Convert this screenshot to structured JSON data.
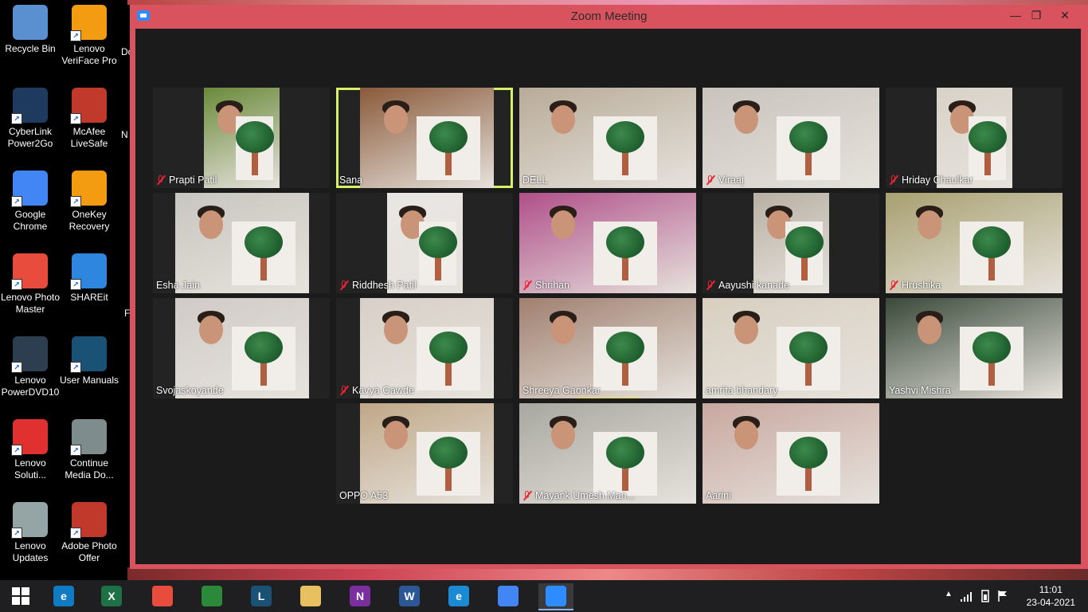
{
  "desktop": {
    "icons": [
      {
        "label": "Recycle Bin",
        "icon": "recycle-bin-icon",
        "color": "#5a8fd0"
      },
      {
        "label": "Lenovo VeriFace Pro",
        "icon": "veriface-icon",
        "color": "#f39c12"
      },
      {
        "label": "CyberLink Power2Go",
        "icon": "power2go-icon",
        "color": "#1e3a5f"
      },
      {
        "label": "McAfee LiveSafe",
        "icon": "mcafee-icon",
        "color": "#c0392b"
      },
      {
        "label": "Google Chrome",
        "icon": "chrome-icon",
        "color": "#4285f4"
      },
      {
        "label": "OneKey Recovery",
        "icon": "onekey-icon",
        "color": "#f39c12"
      },
      {
        "label": "Lenovo Photo Master",
        "icon": "photo-master-icon",
        "color": "#e74c3c"
      },
      {
        "label": "SHAREit",
        "icon": "shareit-icon",
        "color": "#2e86de"
      },
      {
        "label": "Lenovo PowerDVD10",
        "icon": "powerdvd-icon",
        "color": "#2c3e50"
      },
      {
        "label": "User Manuals",
        "icon": "user-manuals-icon",
        "color": "#1a5276"
      },
      {
        "label": "Lenovo Soluti...",
        "icon": "lenovo-solution-icon",
        "color": "#e03030"
      },
      {
        "label": "Continue Media Do...",
        "icon": "media-doc-icon",
        "color": "#7f8c8d"
      },
      {
        "label": "Lenovo Updates",
        "icon": "lenovo-updates-icon",
        "color": "#95a5a6"
      },
      {
        "label": "Adobe Photo Offer",
        "icon": "adobe-icon",
        "color": "#c0392b"
      }
    ],
    "partial": [
      "Do",
      "N",
      "F"
    ]
  },
  "window": {
    "title": "Zoom Meeting",
    "minimize": "—",
    "restore": "❐",
    "close": "✕"
  },
  "participants": [
    {
      "name": "Prapti Patil",
      "muted": true,
      "bg": "#6a8a3a"
    },
    {
      "name": "Sana",
      "muted": false,
      "bg": "#8a5a3a",
      "active": true
    },
    {
      "name": "DELL",
      "muted": false,
      "bg": "#b8ab98"
    },
    {
      "name": "Viraaj",
      "muted": true,
      "bg": "#c8c4bc"
    },
    {
      "name": "Hriday Chaulkar",
      "muted": true,
      "bg": "#d8d2c8"
    },
    {
      "name": "Esha Jain",
      "muted": false,
      "bg": "#c8c6c0"
    },
    {
      "name": "Riddhesh Patil",
      "muted": true,
      "bg": "#e8e6e4"
    },
    {
      "name": "Shrihan",
      "muted": true,
      "bg": "#b0508a"
    },
    {
      "name": "Aayushi kanade",
      "muted": true,
      "bg": "#b8b0a4"
    },
    {
      "name": "Hrushika",
      "muted": true,
      "bg": "#a8a070"
    },
    {
      "name": "Svojaskoyande",
      "muted": false,
      "bg": "#d0cbc8"
    },
    {
      "name": "Kavya Gawde",
      "muted": true,
      "bg": "#d8d0c8"
    },
    {
      "name": "Shreeya Gaonkar",
      "muted": false,
      "bg": "#a08070",
      "speaking": true
    },
    {
      "name": "amrita bhandary",
      "muted": false,
      "bg": "#d8cfc0"
    },
    {
      "name": "Yashvi Mishra",
      "muted": false,
      "bg": "#3a4a3a"
    },
    {
      "name": "OPPO A53",
      "muted": false,
      "bg": "#c0a888"
    },
    {
      "name": "Mayank Umesh Man...",
      "muted": true,
      "bg": "#a8a8a0"
    },
    {
      "name": "Aarini",
      "muted": false,
      "bg": "#c8a8a0"
    }
  ],
  "taskbar": {
    "apps": [
      {
        "name": "edge",
        "icon": "edge-icon",
        "color": "#0f7bc4",
        "glyph": "e"
      },
      {
        "name": "excel",
        "icon": "excel-icon",
        "color": "#1e7145",
        "glyph": "X"
      },
      {
        "name": "photo-master",
        "icon": "photo-master-task-icon",
        "color": "#e74c3c",
        "glyph": ""
      },
      {
        "name": "store",
        "icon": "store-icon",
        "color": "#2a8a3a",
        "glyph": ""
      },
      {
        "name": "lenovo",
        "icon": "lenovo-icon",
        "color": "#1a5276",
        "glyph": "L"
      },
      {
        "name": "explorer",
        "icon": "file-explorer-icon",
        "color": "#e8c060",
        "glyph": ""
      },
      {
        "name": "onenote",
        "icon": "onenote-icon",
        "color": "#7b2f9e",
        "glyph": "N"
      },
      {
        "name": "word",
        "icon": "word-icon",
        "color": "#2b5797",
        "glyph": "W"
      },
      {
        "name": "ie",
        "icon": "internet-explorer-icon",
        "color": "#1a8ad4",
        "glyph": "e"
      },
      {
        "name": "chrome",
        "icon": "chrome-task-icon",
        "color": "#4285f4",
        "glyph": ""
      },
      {
        "name": "zoom",
        "icon": "zoom-icon",
        "color": "#2d8cff",
        "glyph": "",
        "active": true
      }
    ],
    "time": "11:01",
    "date": "23-04-2021"
  }
}
